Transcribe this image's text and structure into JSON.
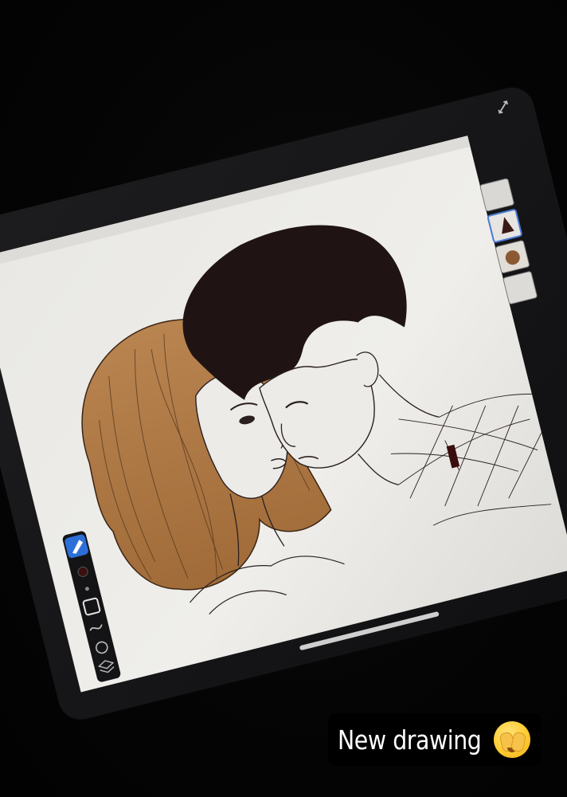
{
  "caption": {
    "text": "New drawing",
    "emoji_icon": "face-with-hand-over-eyes-icon"
  },
  "colors": {
    "background": "#050505",
    "tablet_bezel": "#1a1a1c",
    "canvas": "#ecebe7",
    "hair_light": "#b07a45",
    "hair_dark": "#1f1413",
    "line_art": "#2a2020",
    "accent_brush": "#2d6fd9"
  },
  "tools": {
    "brush_tool_icon": "brush-icon",
    "color_swatch_icon": "color-swatch-icon",
    "square_tool_icon": "square-icon",
    "smudge_tool_icon": "smudge-icon",
    "eraser_tool_icon": "eraser-icon",
    "layers_tool_icon": "layers-icon"
  },
  "layers": {
    "thumbnails": [
      "layer-thumb-1",
      "layer-thumb-2",
      "layer-thumb-3",
      "layer-thumb-4"
    ]
  }
}
